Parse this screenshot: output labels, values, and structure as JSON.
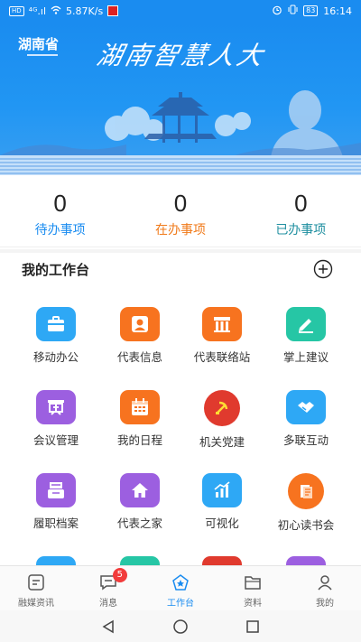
{
  "status_bar": {
    "network_chip": "HD",
    "signal": "⁴ᴳ.ıl",
    "speed": "5.87K/s",
    "battery": "83",
    "time": "16:14"
  },
  "header": {
    "province": "湖南省",
    "title": "湖南智慧人大"
  },
  "stats": [
    {
      "count": "0",
      "label": "待办事项",
      "color": "#1a8cf0"
    },
    {
      "count": "0",
      "label": "在办事项",
      "color": "#f07a1a"
    },
    {
      "count": "0",
      "label": "已办事项",
      "color": "#1f8fa0"
    }
  ],
  "workbench": {
    "title": "我的工作台"
  },
  "apps": [
    {
      "label": "移动办公",
      "icon": "briefcase-icon",
      "color": "#2ea8f5"
    },
    {
      "label": "代表信息",
      "icon": "person-icon",
      "color": "#f7731f"
    },
    {
      "label": "代表联络站",
      "icon": "building-icon",
      "color": "#f7731f"
    },
    {
      "label": "掌上建议",
      "icon": "pen-icon",
      "color": "#26c6a5"
    },
    {
      "label": "会议管理",
      "icon": "meeting-icon",
      "color": "#9c5fe0"
    },
    {
      "label": "我的日程",
      "icon": "calendar-icon",
      "color": "#f7731f"
    },
    {
      "label": "机关党建",
      "icon": "party-icon",
      "color": "#e03a2e"
    },
    {
      "label": "多联互动",
      "icon": "handshake-icon",
      "color": "#2ea8f5"
    },
    {
      "label": "履职档案",
      "icon": "archive-icon",
      "color": "#9c5fe0"
    },
    {
      "label": "代表之家",
      "icon": "home-icon",
      "color": "#9c5fe0"
    },
    {
      "label": "可视化",
      "icon": "chart-icon",
      "color": "#2ea8f5"
    },
    {
      "label": "初心读书会",
      "icon": "book-icon",
      "color": "#f7731f"
    },
    {
      "label": "",
      "icon": "partial-icon",
      "color": "#2ea8f5"
    },
    {
      "label": "",
      "icon": "partial-icon",
      "color": "#26c6a5"
    },
    {
      "label": "",
      "icon": "partial-icon",
      "color": "#e03a2e"
    },
    {
      "label": "",
      "icon": "partial-icon",
      "color": "#9c5fe0"
    }
  ],
  "tabs": [
    {
      "label": "融媒资讯",
      "icon": "news-icon"
    },
    {
      "label": "消息",
      "icon": "message-icon",
      "badge": "5"
    },
    {
      "label": "工作台",
      "icon": "workbench-icon",
      "active": true
    },
    {
      "label": "资料",
      "icon": "folder-icon"
    },
    {
      "label": "我的",
      "icon": "profile-icon"
    }
  ]
}
